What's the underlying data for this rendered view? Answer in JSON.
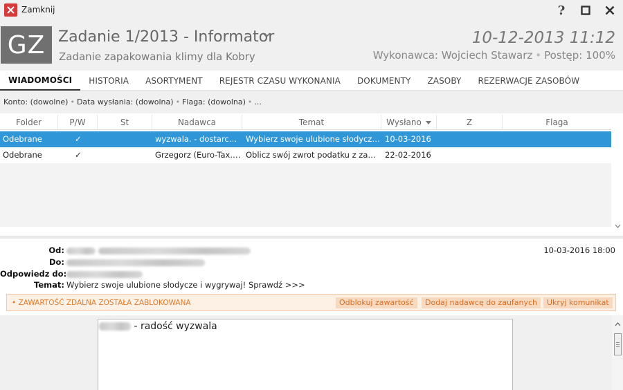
{
  "window": {
    "close_label": "Zamknij",
    "help_glyph": "?"
  },
  "header": {
    "avatar_initials": "GZ",
    "title": "Zadanie 1/2013 - Informator",
    "description": "Zadanie zapakowania klimy dla Kobry",
    "datetime": "10-12-2013 11:12",
    "executor": "Wykonawca: Wojciech Stawarz",
    "progress": "Postęp: 100%"
  },
  "tabs": [
    {
      "label": "WIADOMOŚCI",
      "active": true
    },
    {
      "label": "HISTORIA"
    },
    {
      "label": "ASORTYMENT"
    },
    {
      "label": "REJESTR CZASU WYKONANIA"
    },
    {
      "label": "DOKUMENTY"
    },
    {
      "label": "ZASOBY"
    },
    {
      "label": "REZERWACJE ZASOBÓW"
    }
  ],
  "filter": {
    "account": "Konto: (dowolne)",
    "sent_date": "Data wysłania: (dowolna)",
    "flag": "Flaga: (dowolna)",
    "more": "..."
  },
  "grid": {
    "columns": [
      "Folder",
      "P/W",
      "St",
      "Nadawca",
      "Temat",
      "Wysłano",
      "Z",
      "Flaga"
    ],
    "sort_column": "Wysłano",
    "rows": [
      {
        "folder": "Odebrane",
        "pw": "✓",
        "st": "",
        "sender": "wyzwala. - dostarczo...",
        "subject": "Wybierz swoje ulubione słodycze i...",
        "sent": "10-03-2016",
        "z": "",
        "flag": "",
        "selected": true
      },
      {
        "folder": "Odebrane",
        "pw": "✓",
        "st": "",
        "sender": "Grzegorz (Euro-Tax.pl...",
        "subject": "Oblicz swój zwrot podatku z zagran...",
        "sent": "22-02-2016",
        "z": "",
        "flag": ""
      }
    ]
  },
  "preview": {
    "from_label": "Od:",
    "to_label": "Do:",
    "reply_label": "Odpowiedz do:",
    "subject_label": "Temat:",
    "from_value": "wyzwala",
    "reply_value": "no-reply",
    "subject": "Wybierz swoje ulubione słodycze i wygrywaj! Sprawdź >>>",
    "date": "10-03-2016 18:00",
    "blocked_notice": "• ZAWARTOŚĆ ZDALNA ZOSTAŁA ZABLOKOWANA",
    "unblock_label": "Odblokuj zawartość",
    "trust_label": "Dodaj nadawcę do zaufanych",
    "hide_label": "Ukryj komunikat",
    "body_text": "- radość wyzwala"
  }
}
